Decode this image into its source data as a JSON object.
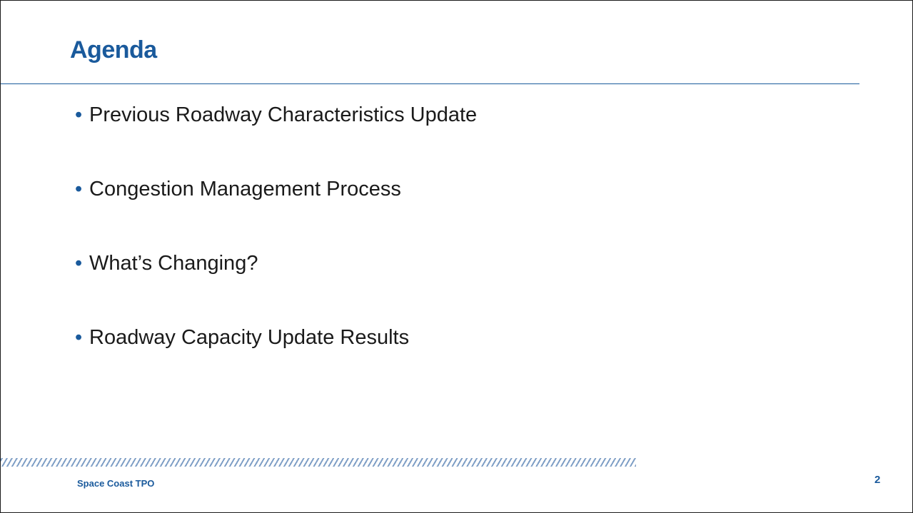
{
  "slide": {
    "title": "Agenda",
    "items": [
      {
        "bullet": "•",
        "label": "Previous Roadway Characteristics Update"
      },
      {
        "bullet": "•",
        "label": "Congestion Management Process"
      },
      {
        "bullet": "•",
        "label": "What’s Changing?"
      },
      {
        "bullet": "•",
        "label": "Roadway Capacity Update Results"
      }
    ],
    "footer": {
      "organization": "Space Coast TPO",
      "page_number": "2"
    }
  },
  "colors": {
    "accent": "#1a5a9c",
    "text": "#1a1a1a",
    "stripe": "#7f9fc6",
    "background": "#ffffff"
  }
}
